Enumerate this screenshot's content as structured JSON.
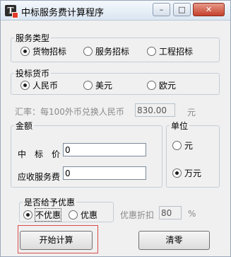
{
  "window": {
    "title": "中标服务费计算程序",
    "app_icon_glyph": "T",
    "minimize_glyph": "–",
    "maximize_glyph": "□",
    "close_glyph": "✕"
  },
  "service_type": {
    "legend": "服务类型",
    "options": [
      "货物招标",
      "服务招标",
      "工程招标"
    ],
    "selected": 0
  },
  "currency": {
    "legend": "投标货币",
    "options": [
      "人民币",
      "美元",
      "欧元"
    ],
    "selected": 0
  },
  "exchange": {
    "label": "汇率：每100外币兑换人民币",
    "value": "830.00",
    "unit": "元"
  },
  "amount": {
    "legend": "金额",
    "bid_price_label": "中　标　价",
    "bid_price_value": "0",
    "fee_label": "应收服务费",
    "fee_value": "0"
  },
  "unit": {
    "legend": "单位",
    "options": [
      "元",
      "万元"
    ],
    "selected": 1
  },
  "discount": {
    "legend": "是否给予优惠",
    "options": [
      "不优惠",
      "优惠"
    ],
    "selected": 0,
    "rate_label": "优惠折扣",
    "rate_value": "80",
    "rate_unit": "%"
  },
  "buttons": {
    "start": "开始计算",
    "clear": "清零"
  }
}
